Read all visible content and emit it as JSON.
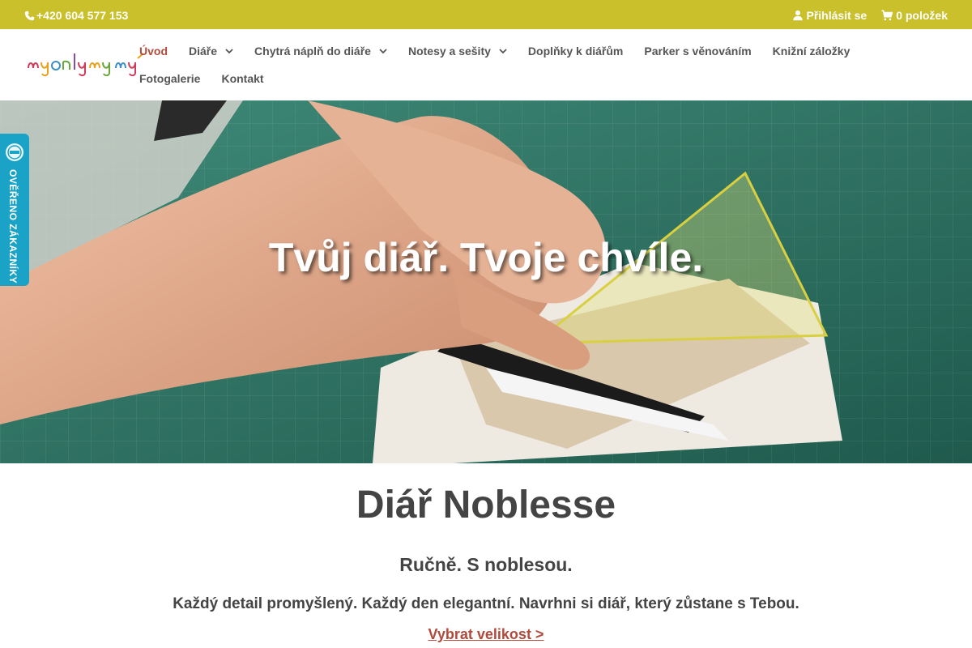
{
  "topbar": {
    "phone": "+420 604 577 153",
    "login": "Přihlásit se",
    "cart": "0 položek",
    "bg_color": "#c9c02b"
  },
  "logo": {
    "text": "myonlymy"
  },
  "nav": {
    "items": [
      {
        "label": "Úvod",
        "active": true,
        "has_submenu": false
      },
      {
        "label": "Diáře",
        "has_submenu": true
      },
      {
        "label": "Chytrá náplň do diáře",
        "has_submenu": true
      },
      {
        "label": "Notesy a sešity",
        "has_submenu": true
      },
      {
        "label": "Doplňky k diářům",
        "has_submenu": false
      },
      {
        "label": "Parker s věnováním",
        "has_submenu": false
      },
      {
        "label": "Knižní záložky",
        "has_submenu": false
      },
      {
        "label": "Fotogalerie",
        "has_submenu": false
      },
      {
        "label": "Kontakt",
        "has_submenu": false
      }
    ],
    "active_color": "#b04a3b"
  },
  "hero": {
    "title": "Tvůj diář. Tvoje chvíle."
  },
  "badge": {
    "text": "OVĚŘENO ZÁKAZNÍKY",
    "color": "#1aa3c7"
  },
  "product": {
    "title": "Diář Noblesse",
    "subtitle": "Ručně. S noblesou.",
    "description": "Každý detail promyšlený. Každý den elegantní. Navrhni si diář, který zůstane s Tebou.",
    "link": "Vybrat velikost >"
  }
}
